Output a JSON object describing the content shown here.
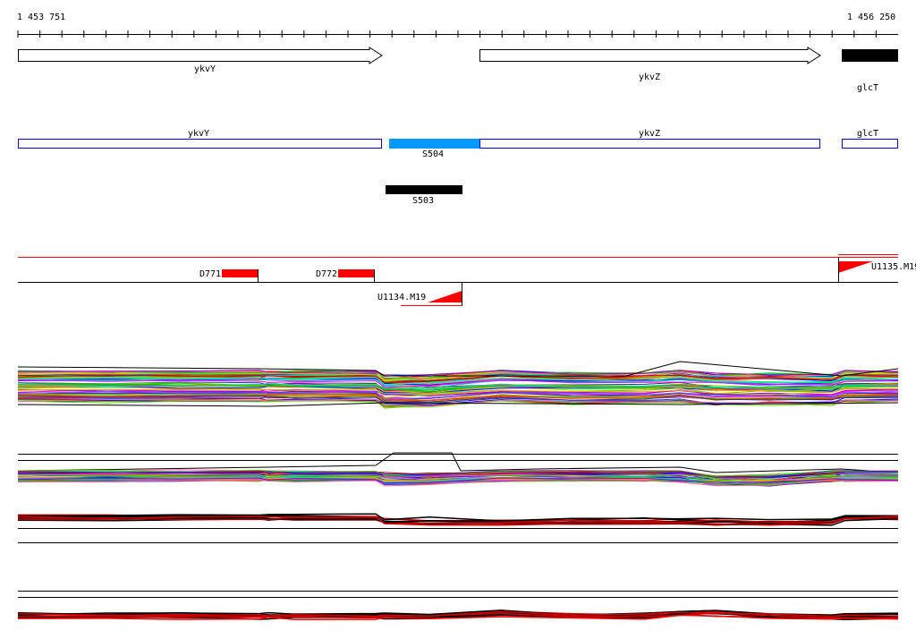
{
  "coordinates": {
    "start": "1 453 751",
    "end": "1 456 250"
  },
  "genes": [
    {
      "name": "ykvY",
      "strand": "+"
    },
    {
      "name": "ykvZ",
      "strand": "+"
    },
    {
      "name": "glcT",
      "strand": "+"
    }
  ],
  "transcripts": [
    {
      "name": "ykvY"
    },
    {
      "name": "ykvZ"
    },
    {
      "name": "glcT"
    }
  ],
  "segments": [
    {
      "name": "S504",
      "color": "#0099ff"
    },
    {
      "name": "S503",
      "color": "#000000"
    }
  ],
  "features": [
    {
      "name": "D771",
      "color": "#ff0000"
    },
    {
      "name": "D772",
      "color": "#ff0000"
    },
    {
      "name": "U1134.M19",
      "color": "#ff0000"
    },
    {
      "name": "U1135.M19",
      "color": "#ff0000"
    }
  ],
  "colors": {
    "accent_red": "#ff0000",
    "accent_blue": "#0000cc",
    "segment_blue": "#0099ff"
  }
}
